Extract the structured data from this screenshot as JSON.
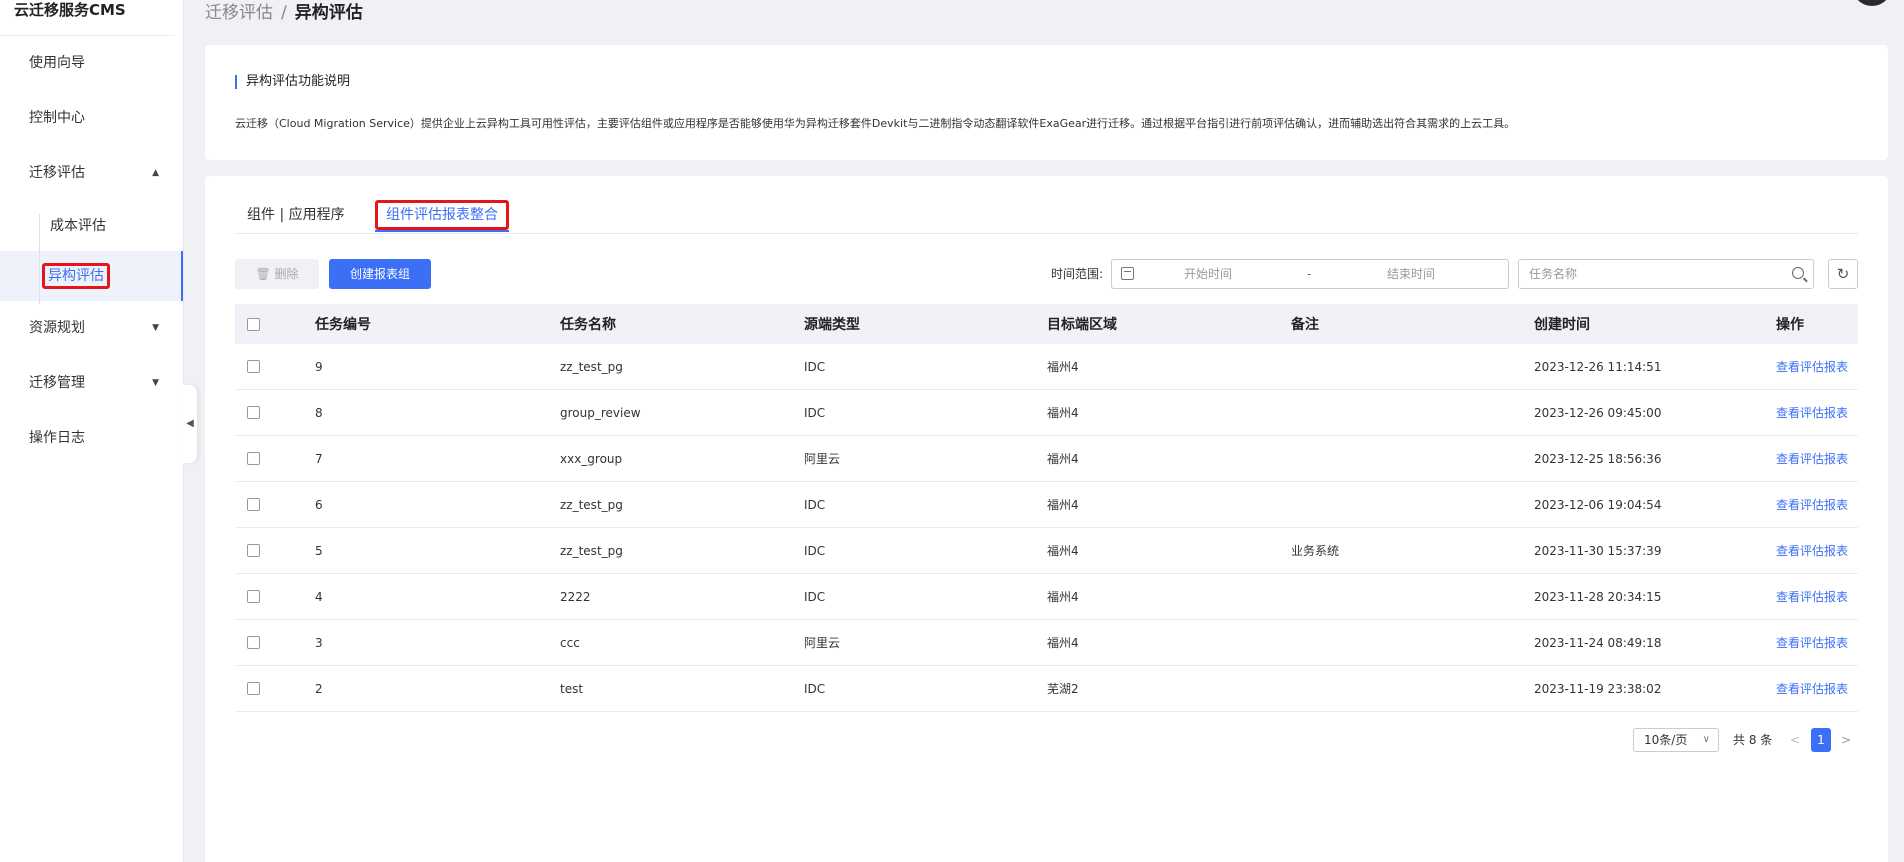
{
  "app": {
    "title": "云迁移服务CMS"
  },
  "sidebar": {
    "items": [
      {
        "label": "使用向导"
      },
      {
        "label": "控制中心"
      },
      {
        "label": "迁移评估",
        "arrow": "▲"
      },
      {
        "label": "资源规划",
        "arrow": "▼"
      },
      {
        "label": "迁移管理",
        "arrow": "▼"
      },
      {
        "label": "操作日志"
      }
    ],
    "subitems": [
      {
        "label": "成本评估"
      },
      {
        "label": "异构评估"
      }
    ],
    "collapse_icon": "◀"
  },
  "breadcrumb": {
    "parent": "迁移评估",
    "separator": "/",
    "current": "异构评估"
  },
  "description": {
    "title": "异构评估功能说明",
    "text": "云迁移（Cloud Migration Service）提供企业上云异构工具可用性评估，主要评估组件或应用程序是否能够使用华为异构迁移套件Devkit与二进制指令动态翻译软件ExaGear进行迁移。通过根据平台指引进行前项评估确认，进而辅助选出符合其需求的上云工具。"
  },
  "tabs": [
    {
      "label": "组件 | 应用程序"
    },
    {
      "label": "组件评估报表整合",
      "active": true
    }
  ],
  "toolbar": {
    "delete_label": "删除",
    "delete_icon": "🗑",
    "create_label": "创建报表组",
    "range_label": "时间范围:",
    "start_placeholder": "开始时间",
    "range_dash": "-",
    "end_placeholder": "结束时间",
    "search_placeholder": "任务名称",
    "refresh_icon": "↻"
  },
  "table": {
    "headers": [
      "任务编号",
      "任务名称",
      "源端类型",
      "目标端区域",
      "备注",
      "创建时间",
      "操作"
    ],
    "rows": [
      {
        "id": "9",
        "name": "zz_test_pg",
        "src": "IDC",
        "region": "福州4",
        "note": "",
        "time": "2023-12-26 11:14:51",
        "op": "查看评估报表"
      },
      {
        "id": "8",
        "name": "group_review",
        "src": "IDC",
        "region": "福州4",
        "note": "",
        "time": "2023-12-26 09:45:00",
        "op": "查看评估报表"
      },
      {
        "id": "7",
        "name": "xxx_group",
        "src": "阿里云",
        "region": "福州4",
        "note": "",
        "time": "2023-12-25 18:56:36",
        "op": "查看评估报表"
      },
      {
        "id": "6",
        "name": "zz_test_pg",
        "src": "IDC",
        "region": "福州4",
        "note": "",
        "time": "2023-12-06 19:04:54",
        "op": "查看评估报表"
      },
      {
        "id": "5",
        "name": "zz_test_pg",
        "src": "IDC",
        "region": "福州4",
        "note": "业务系统",
        "time": "2023-11-30 15:37:39",
        "op": "查看评估报表"
      },
      {
        "id": "4",
        "name": "2222",
        "src": "IDC",
        "region": "福州4",
        "note": "",
        "time": "2023-11-28 20:34:15",
        "op": "查看评估报表"
      },
      {
        "id": "3",
        "name": "ccc",
        "src": "阿里云",
        "region": "福州4",
        "note": "",
        "time": "2023-11-24 08:49:18",
        "op": "查看评估报表"
      },
      {
        "id": "2",
        "name": "test",
        "src": "IDC",
        "region": "芜湖2",
        "note": "",
        "time": "2023-11-19 23:38:02",
        "op": "查看评估报表"
      }
    ]
  },
  "pagination": {
    "page_size": "10条/页",
    "dropdown_icon": "∨",
    "total": "共 8 条",
    "prev_icon": "<",
    "current_page": "1",
    "next_icon": ">"
  },
  "colors": {
    "accent": "#3b6ff5",
    "highlight": "#e4161a"
  }
}
